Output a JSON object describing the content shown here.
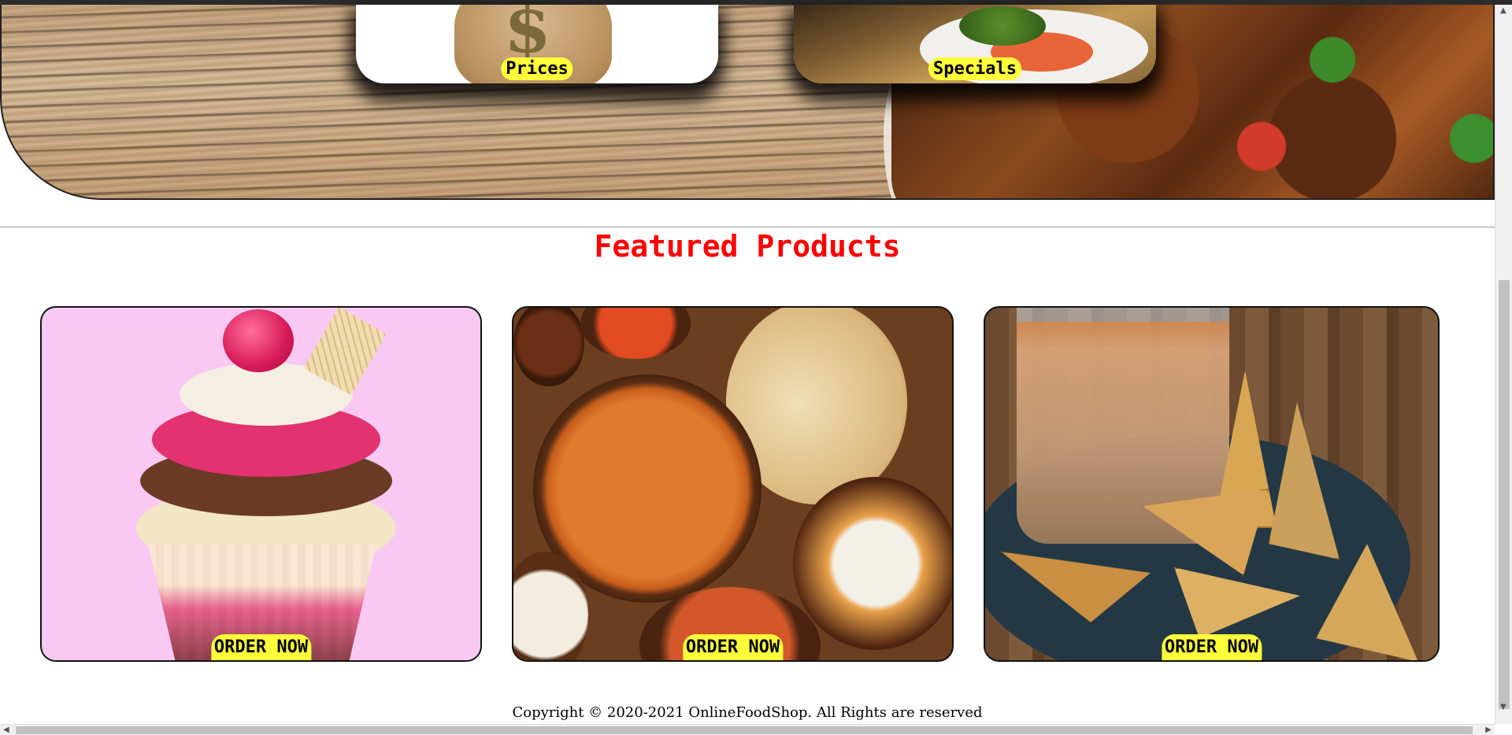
{
  "hero": {
    "cards": [
      {
        "label": "Prices"
      },
      {
        "label": "Specials"
      }
    ],
    "dollar_symbol": "$"
  },
  "featured": {
    "title": "Featured Products",
    "products": [
      {
        "button_label": "ORDER NOW",
        "image": "cupcake"
      },
      {
        "button_label": "ORDER NOW",
        "image": "indian-thali"
      },
      {
        "button_label": "ORDER NOW",
        "image": "tea-and-samosa"
      }
    ]
  },
  "footer": {
    "copyright": "Copyright © 2020-2021 OnlineFoodShop. All Rights are reserved"
  },
  "colors": {
    "title_red": "#ff0000",
    "button_yellow": "#ffff3a"
  }
}
